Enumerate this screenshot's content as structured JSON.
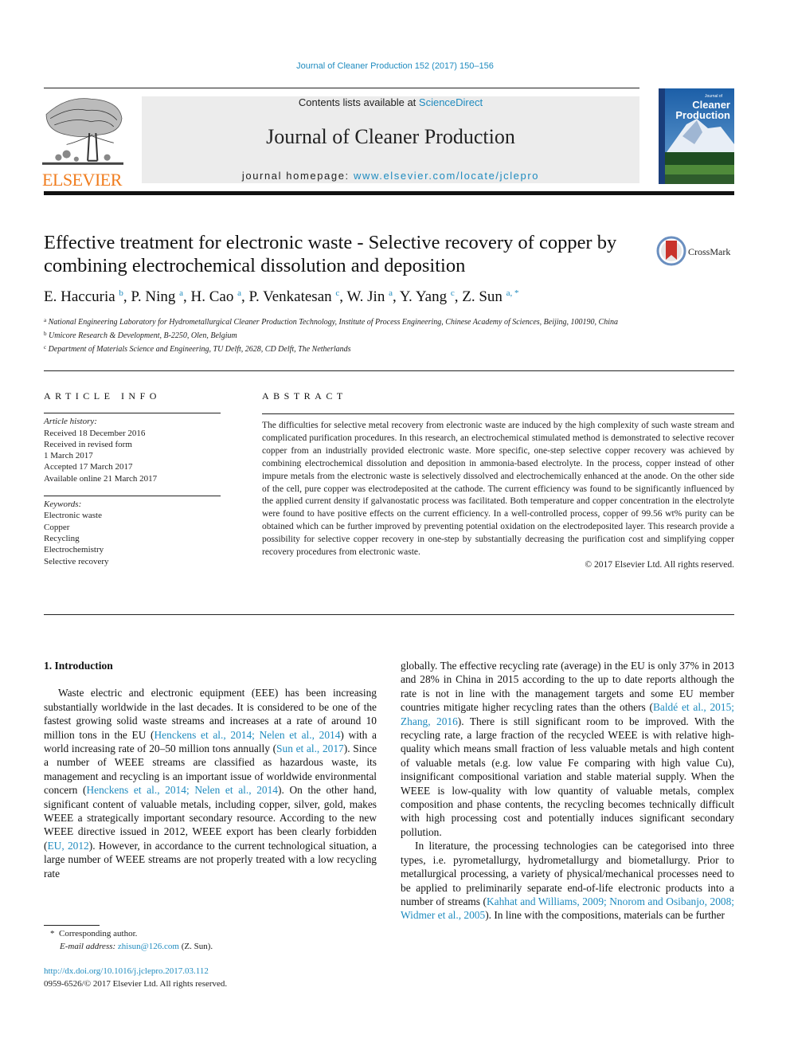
{
  "header": {
    "journal_ref": "Journal of Cleaner Production 152 (2017) 150–156",
    "contents_prefix": "Contents lists available at ",
    "contents_link": "ScienceDirect",
    "journal_title": "Journal of Cleaner Production",
    "homepage_prefix": "journal homepage: ",
    "homepage_link": "www.elsevier.com/locate/jclepro",
    "publisher_wordmark": "ELSEVIER",
    "cover_title_line1": "Cleaner",
    "cover_title_line2": "Production",
    "cover_small": "Journal of"
  },
  "article": {
    "title": "Effective treatment for electronic waste - Selective recovery of copper by combining electrochemical dissolution and deposition",
    "crossmark_label": "CrossMark",
    "authors": [
      {
        "name": "E. Haccuria",
        "sup": "b",
        "sep": ", "
      },
      {
        "name": "P. Ning",
        "sup": "a",
        "sep": ", "
      },
      {
        "name": "H. Cao",
        "sup": "a",
        "sep": ", "
      },
      {
        "name": "P. Venkatesan",
        "sup": "c",
        "sep": ", "
      },
      {
        "name": "W. Jin",
        "sup": "a",
        "sep": ", "
      },
      {
        "name": "Y. Yang",
        "sup": "c",
        "sep": ", "
      },
      {
        "name": "Z. Sun",
        "sup": "a, *",
        "sep": ""
      }
    ],
    "affiliations": [
      {
        "mark": "a",
        "text": "National Engineering Laboratory for Hydrometallurgical Cleaner Production Technology, Institute of Process Engineering, Chinese Academy of Sciences, Beijing, 100190, China"
      },
      {
        "mark": "b",
        "text": "Umicore Research & Development, B-2250, Olen, Belgium"
      },
      {
        "mark": "c",
        "text": "Department of Materials Science and Engineering, TU Delft, 2628, CD Delft, The Netherlands"
      }
    ]
  },
  "article_info": {
    "label": "ARTICLE INFO",
    "history_label": "Article history:",
    "history": [
      "Received 18 December 2016",
      "Received in revised form",
      "1 March 2017",
      "Accepted 17 March 2017",
      "Available online 21 March 2017"
    ],
    "keywords_label": "Keywords:",
    "keywords": [
      "Electronic waste",
      "Copper",
      "Recycling",
      "Electrochemistry",
      "Selective recovery"
    ]
  },
  "abstract": {
    "label": "ABSTRACT",
    "text": "The difficulties for selective metal recovery from electronic waste are induced by the high complexity of such waste stream and complicated purification procedures. In this research, an electrochemical stimulated method is demonstrated to selective recover copper from an industrially provided electronic waste. More specific, one-step selective copper recovery was achieved by combining electrochemical dissolution and deposition in ammonia-based electrolyte. In the process, copper instead of other impure metals from the electronic waste is selectively dissolved and electrochemically enhanced at the anode. On the other side of the cell, pure copper was electrodeposited at the cathode. The current efficiency was found to be significantly influenced by the applied current density if galvanostatic process was facilitated. Both temperature and copper concentration in the electrolyte were found to have positive effects on the current efficiency. In a well-controlled process, copper of 99.56 wt% purity can be obtained which can be further improved by preventing potential oxidation on the electrodeposited layer. This research provide a possibility for selective copper recovery in one-step by substantially decreasing the purification cost and simplifying copper recovery procedures from electronic waste.",
    "copyright": "© 2017 Elsevier Ltd. All rights reserved."
  },
  "intro": {
    "heading": "1.  Introduction",
    "col1": [
      {
        "t": "Waste electric and electronic equipment (EEE) has been increasing substantially worldwide in the last decades. It is considered to be one of the fastest growing solid waste streams and increases at a rate of around 10 million tons in the EU ("
      },
      {
        "l": "Henckens et al., 2014; Nelen et al., 2014"
      },
      {
        "t": ") with a world increasing rate of 20–50 million tons annually ("
      },
      {
        "l": "Sun et al., 2017"
      },
      {
        "t": "). Since a number of WEEE streams are classified as hazardous waste, its management and recycling is an important issue of worldwide environmental concern ("
      },
      {
        "l": "Henckens et al., 2014; Nelen et al., 2014"
      },
      {
        "t": "). On the other hand, significant content of valuable metals, including copper, silver, gold, makes WEEE a strategically important secondary resource. According to the new WEEE directive issued in 2012, WEEE export has been clearly forbidden ("
      },
      {
        "l": "EU, 2012"
      },
      {
        "t": "). However, in accordance to the current technological situation, a large number of WEEE streams are not properly treated with a low recycling rate"
      }
    ],
    "col2_p1": [
      {
        "t": "globally. The effective recycling rate (average) in the EU is only 37% in 2013 and 28% in China in 2015 according to the up to date reports although the rate is not in line with the management targets and some EU member countries mitigate higher recycling rates than the others ("
      },
      {
        "l": "Baldé et al., 2015; Zhang, 2016"
      },
      {
        "t": "). There is still significant room to be improved. With the recycling rate, a large fraction of the recycled WEEE is with relative high-quality which means small fraction of less valuable metals and high content of valuable metals (e.g. low value Fe comparing with high value Cu), insignificant compositional variation and stable material supply. When the WEEE is low-quality with low quantity of valuable metals, complex composition and phase contents, the recycling becomes technically difficult with high processing cost and potentially induces significant secondary pollution."
      }
    ],
    "col2_p2": [
      {
        "t": "In literature, the processing technologies can be categorised into three types, i.e. pyrometallurgy, hydrometallurgy and biometallurgy. Prior to metallurgical processing, a variety of physical/mechanical processes need to be applied to preliminarily separate end-of-life electronic products into a number of streams ("
      },
      {
        "l": "Kahhat and Williams, 2009; Nnorom and Osibanjo, 2008; Widmer et al., 2005"
      },
      {
        "t": "). In line with the compositions, materials can be further"
      }
    ]
  },
  "footnote": {
    "star": "*",
    "corresponding": "Corresponding author.",
    "email_label": "E-mail address: ",
    "email": "zhisun@126.com",
    "email_suffix": " (Z. Sun)."
  },
  "doi": {
    "url": "http://dx.doi.org/10.1016/j.jclepro.2017.03.112",
    "issn_line": "0959-6526/© 2017 Elsevier Ltd. All rights reserved."
  },
  "colors": {
    "link": "#1f8bbf",
    "elsevier_orange": "#f07c1d",
    "banner_bg": "#ececec"
  }
}
